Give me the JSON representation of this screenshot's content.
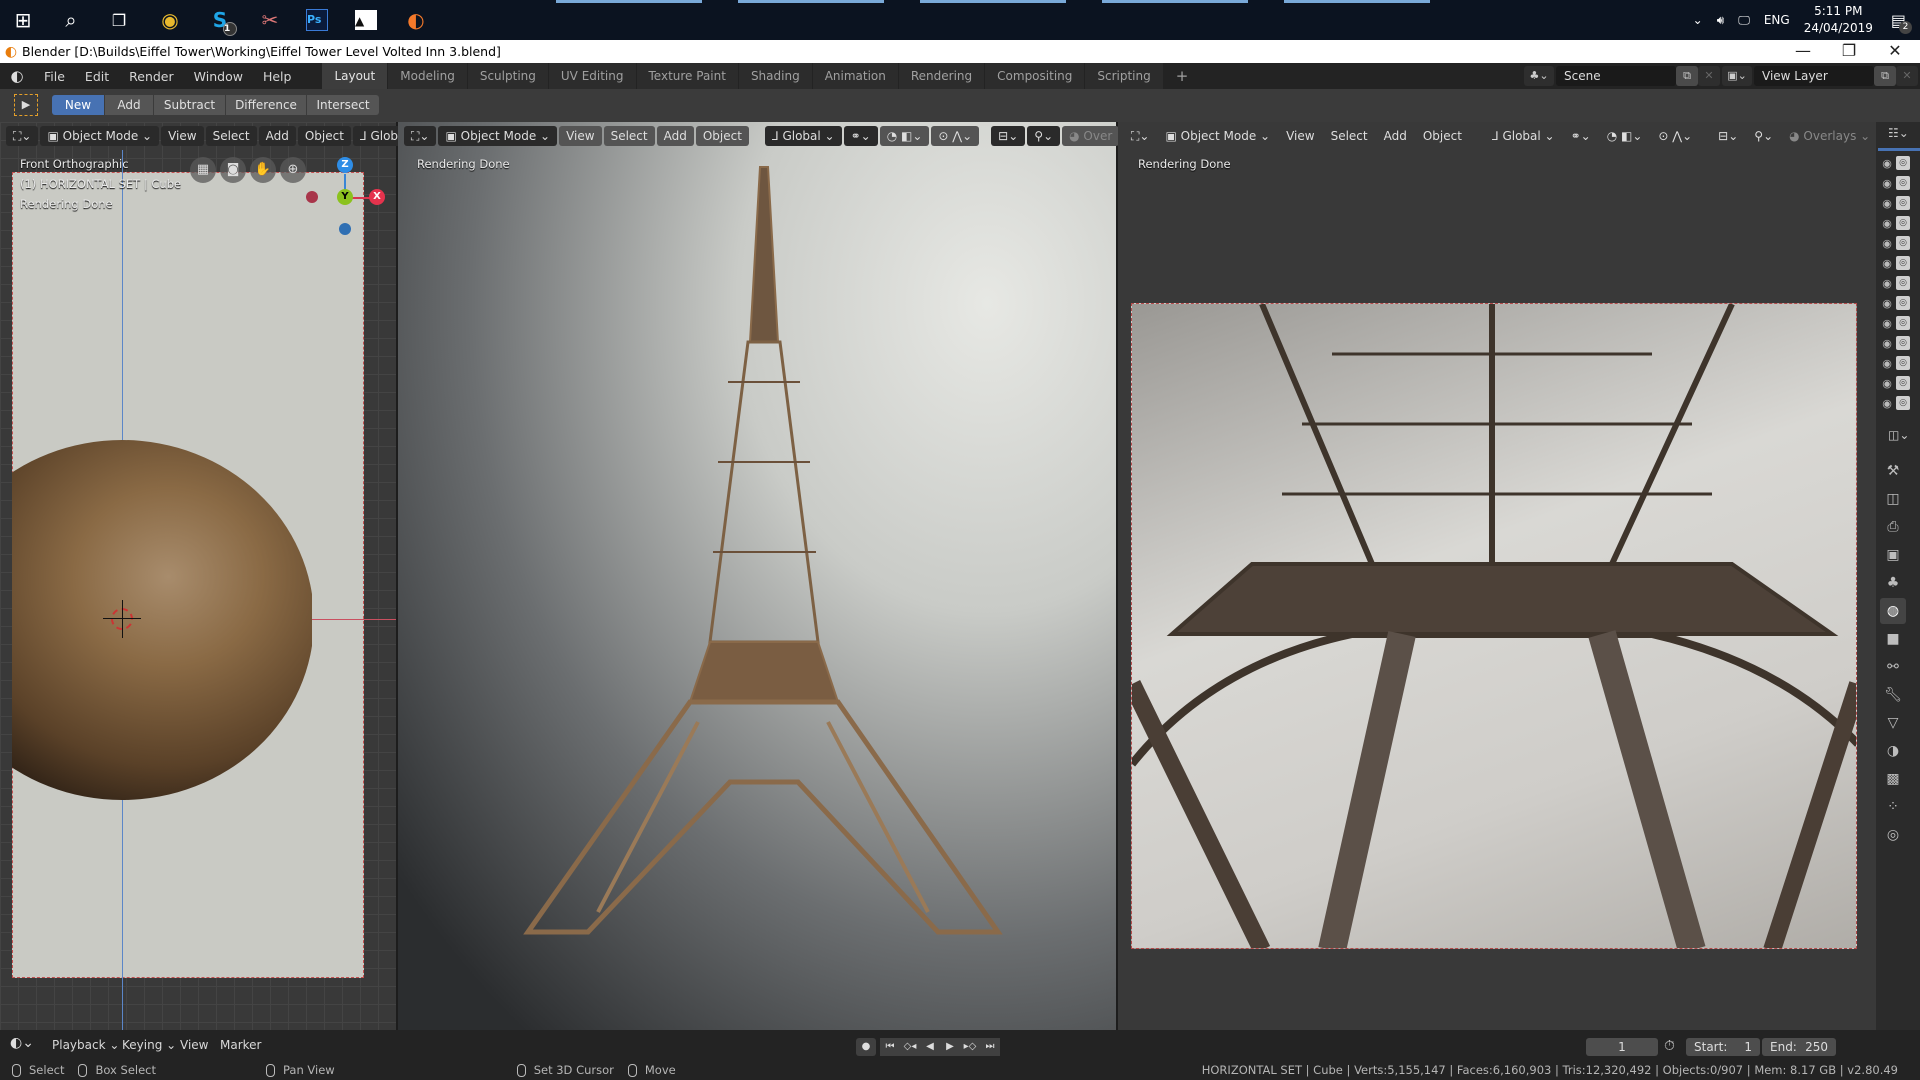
{
  "taskbar": {
    "apps": [
      {
        "name": "windows-start",
        "glyph": "⊞"
      },
      {
        "name": "search",
        "glyph": "⌕"
      },
      {
        "name": "task-view",
        "glyph": "❐"
      },
      {
        "name": "chrome",
        "glyph": "◉"
      },
      {
        "name": "skype",
        "glyph": "S",
        "badge": "1"
      },
      {
        "name": "snipping-tool",
        "glyph": "✂"
      },
      {
        "name": "photoshop",
        "glyph": "Ps"
      },
      {
        "name": "photos",
        "glyph": "▲"
      },
      {
        "name": "blender",
        "glyph": "◐"
      }
    ],
    "tray": {
      "language": "ENG",
      "time": "5:11 PM",
      "date": "24/04/2019",
      "notification_count": "2"
    }
  },
  "window": {
    "title": "Blender [D:\\Builds\\Eiffel Tower\\Working\\Eiffel Tower Level Volted Inn 3.blend]",
    "buttons": {
      "minimize": "—",
      "restore": "❐",
      "close": "✕"
    }
  },
  "menu": [
    "File",
    "Edit",
    "Render",
    "Window",
    "Help"
  ],
  "workspaces": [
    {
      "label": "Layout",
      "active": true
    },
    {
      "label": "Modeling"
    },
    {
      "label": "Sculpting"
    },
    {
      "label": "UV Editing"
    },
    {
      "label": "Texture Paint"
    },
    {
      "label": "Shading"
    },
    {
      "label": "Animation"
    },
    {
      "label": "Rendering"
    },
    {
      "label": "Compositing"
    },
    {
      "label": "Scripting"
    }
  ],
  "add_workspace": "+",
  "scene": {
    "label": "Scene",
    "view_layer": "View Layer"
  },
  "tool_header": {
    "modes": [
      "New",
      "Add",
      "Subtract",
      "Difference",
      "Intersect"
    ],
    "active_mode": "New"
  },
  "viewport_left": {
    "header": {
      "mode": "Object Mode",
      "menus": [
        "View",
        "Select",
        "Add",
        "Object"
      ],
      "orientation": "Glob"
    },
    "view_name": "Front Orthographic",
    "collection": "(1) HORIZONTAL SET | Cube",
    "status": "Rendering Done",
    "gizmo": {
      "z": "Z",
      "y": "Y",
      "x": "X"
    }
  },
  "viewport_center": {
    "header": {
      "mode": "Object Mode",
      "menus": [
        "View",
        "Select",
        "Add",
        "Object"
      ],
      "orientation": "Global",
      "overlays": "Over"
    },
    "status": "Rendering Done"
  },
  "viewport_right": {
    "header": {
      "mode": "Object Mode",
      "menus": [
        "View",
        "Select",
        "Add",
        "Object"
      ],
      "orientation": "Global",
      "overlays": "Overlays"
    },
    "status": "Rendering Done"
  },
  "outliner_rows": 13,
  "properties_tabs": [
    "tool",
    "render",
    "output",
    "view-layer",
    "scene",
    "world",
    "object",
    "constraints",
    "modifiers",
    "mesh-data",
    "material",
    "texture",
    "particles",
    "physics"
  ],
  "properties_active_tab": "world",
  "timeline": {
    "menus": [
      "Playback",
      "Keying",
      "View",
      "Marker"
    ],
    "current_frame": "1",
    "start_label": "Start:",
    "start": "1",
    "end_label": "End:",
    "end": "250"
  },
  "statusbar": {
    "hints": [
      "Select",
      "Box Select",
      "Pan View",
      "Set 3D Cursor",
      "Move"
    ],
    "info": "HORIZONTAL SET | Cube | Verts:5,155,147 | Faces:6,160,903 | Tris:12,320,492 | Objects:0/907 | Mem: 8.17 GB | v2.80.49"
  },
  "colors": {
    "accent": "#4772b3",
    "axis_x": "#e5334d",
    "axis_y": "#8bc21e",
    "axis_z": "#2e8de6",
    "camera_frame": "#c35050"
  }
}
